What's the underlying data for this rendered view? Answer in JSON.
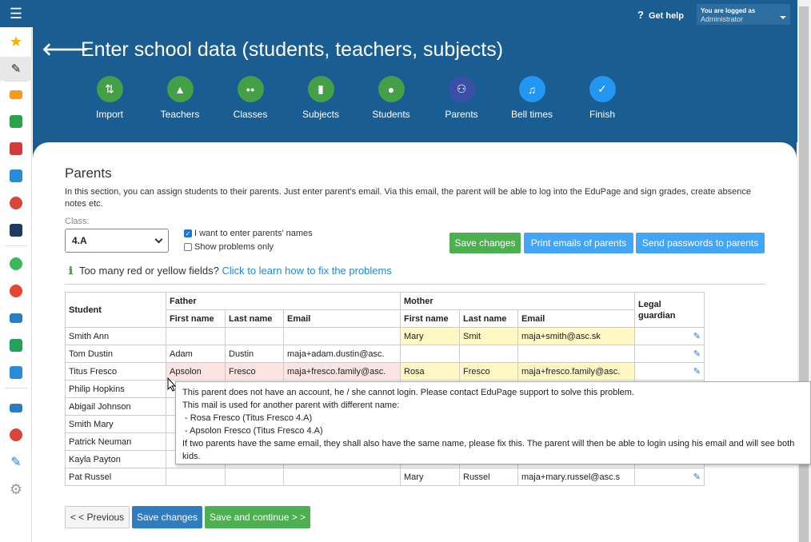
{
  "topbar": {
    "help": "Get help",
    "account_l1": "You are logged as",
    "account_l2": "Administrator"
  },
  "page": {
    "title": "Enter school data (students, teachers, subjects)"
  },
  "steps": [
    {
      "label": "Import",
      "icon": "import-icon",
      "color": "#43a047"
    },
    {
      "label": "Teachers",
      "icon": "graduation-cap-icon",
      "color": "#43a047"
    },
    {
      "label": "Classes",
      "icon": "group-icon",
      "color": "#43a047"
    },
    {
      "label": "Subjects",
      "icon": "book-icon",
      "color": "#43a047"
    },
    {
      "label": "Students",
      "icon": "person-icon",
      "color": "#43a047"
    },
    {
      "label": "Parents",
      "icon": "parents-icon",
      "color": "#3a4fa8"
    },
    {
      "label": "Bell times",
      "icon": "bell-icon",
      "color": "#2196f3"
    },
    {
      "label": "Finish",
      "icon": "check-icon",
      "color": "#2196f3"
    }
  ],
  "section": {
    "title": "Parents",
    "desc": "In this section, you can assign students to their parents. Just enter parent's email. Via this email, the parent will be able to log into the EduPage and sign grades, create absence notes etc."
  },
  "filters": {
    "class_label": "Class:",
    "class_value": "4.A",
    "chk1": "I want to enter parents' names",
    "chk1_checked": true,
    "chk2": "Show problems only",
    "chk2_checked": false
  },
  "actions": {
    "save": "Save changes",
    "print": "Print emails of parents",
    "send": "Send passwords to parents"
  },
  "warning": {
    "text": "Too many red or yellow fields?",
    "link": "Click to learn how to fix the problems"
  },
  "table": {
    "h_student": "Student",
    "h_father": "Father",
    "h_mother": "Mother",
    "h_legal": "Legal guardian",
    "h_first": "First name",
    "h_last": "Last name",
    "h_email": "Email",
    "rows": [
      {
        "student": "Smith Ann",
        "f_first": "",
        "f_last": "",
        "f_email": "",
        "m_first": "Mary",
        "m_last": "Smit",
        "m_email": "maja+smith@asc.sk"
      },
      {
        "student": "Tom Dustin",
        "f_first": "Adam",
        "f_last": "Dustin",
        "f_email": "maja+adam.dustin@asc.",
        "m_first": "",
        "m_last": "",
        "m_email": ""
      },
      {
        "student": "Titus Fresco",
        "f_first": "Apsolon",
        "f_last": "Fresco",
        "f_email": "maja+fresco.family@asc.",
        "m_first": "Rosa",
        "m_last": "Fresco",
        "m_email": "maja+fresco.family@asc."
      },
      {
        "student": "Philip Hopkins",
        "f_first": "",
        "f_last": "",
        "f_email": "",
        "m_first": "",
        "m_last": "",
        "m_email": ""
      },
      {
        "student": "Abigail Johnson",
        "f_first": "",
        "f_last": "",
        "f_email": "",
        "m_first": "",
        "m_last": "",
        "m_email": ""
      },
      {
        "student": "Smith Mary",
        "f_first": "",
        "f_last": "",
        "f_email": "",
        "m_first": "",
        "m_last": "",
        "m_email": ""
      },
      {
        "student": "Patrick Neuman",
        "f_first": "",
        "f_last": "",
        "f_email": "",
        "m_first": "",
        "m_last": "",
        "m_email": ""
      },
      {
        "student": "Kayla Payton",
        "f_first": "",
        "f_last": "",
        "f_email": "",
        "m_first": "",
        "m_last": "",
        "m_email": ""
      },
      {
        "student": "Pat Russel",
        "f_first": "",
        "f_last": "",
        "f_email": "",
        "m_first": "Mary",
        "m_last": "Russel",
        "m_email": "maja+mary.russel@asc.s"
      }
    ]
  },
  "tooltip": {
    "l1": "This parent does not have an account, he / she cannot login. Please contact EduPage support to solve this problem.",
    "l2": "This mail is used for another parent with different name:",
    "l3": " - Rosa Fresco (Titus Fresco 4.A)",
    "l4": " - Apsolon Fresco (Titus Fresco 4.A)",
    "l5": "If two parents have the same email, they shall also have the same name, please fix this. The parent will then be able to login using his email and will see both kids."
  },
  "footer": {
    "prev": "< < Previous",
    "save": "Save changes",
    "save_continue": "Save and continue > >"
  }
}
